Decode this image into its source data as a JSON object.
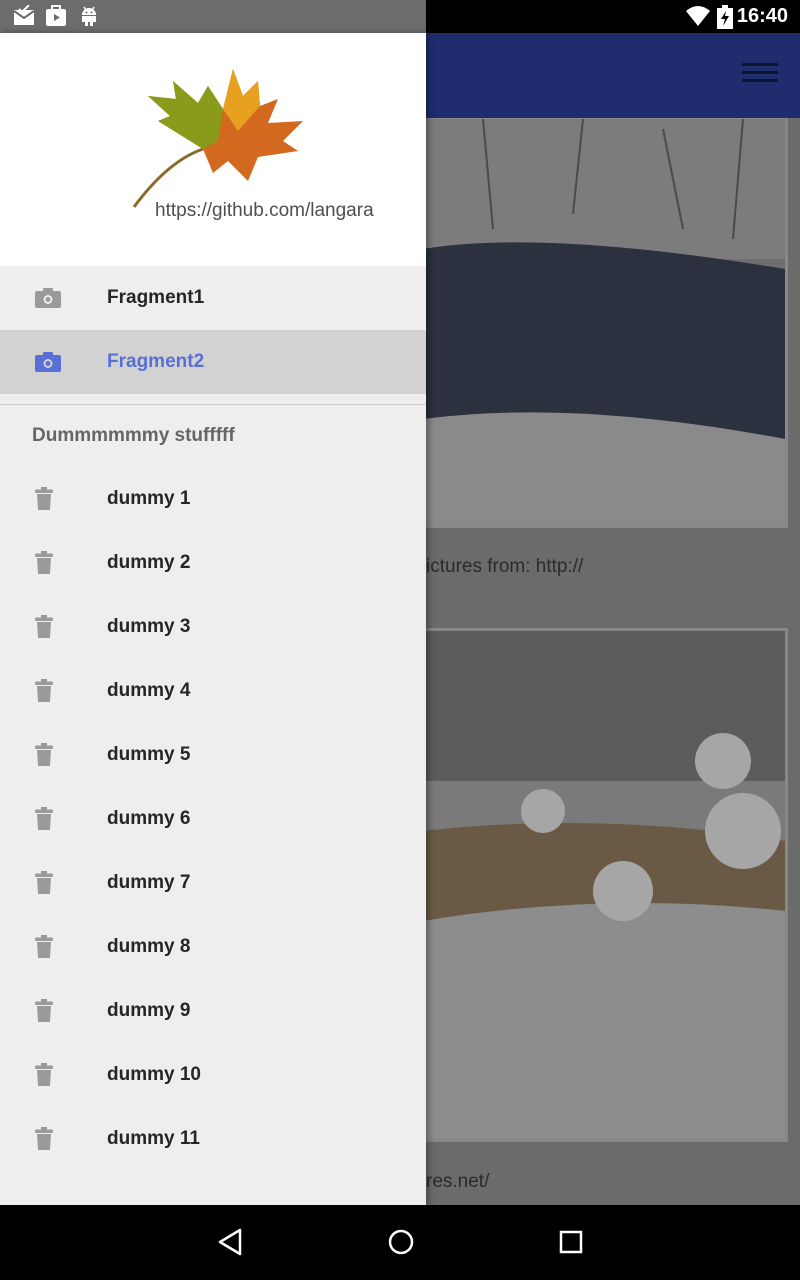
{
  "status_bar": {
    "time": "16:40",
    "left_icons": [
      "mail-icon",
      "play-store-icon",
      "android-icon"
    ],
    "right_icons": [
      "wifi-icon",
      "battery-charging-icon"
    ]
  },
  "toolbar": {
    "menu_icon": "menu-icon"
  },
  "content": {
    "credit_line_1": "ictures from: http://",
    "credit_line_2": "res.net/"
  },
  "drawer": {
    "header_link": "https://github.com/langara",
    "primary_items": [
      {
        "label": "Fragment1",
        "icon": "camera-icon",
        "active": false
      },
      {
        "label": "Fragment2",
        "icon": "camera-icon",
        "active": true
      }
    ],
    "section_title": "Dummmmmmy stufffff",
    "dummy_items": [
      {
        "label": "dummy 1",
        "icon": "trash-icon"
      },
      {
        "label": "dummy 2",
        "icon": "trash-icon"
      },
      {
        "label": "dummy 3",
        "icon": "trash-icon"
      },
      {
        "label": "dummy 4",
        "icon": "trash-icon"
      },
      {
        "label": "dummy 5",
        "icon": "trash-icon"
      },
      {
        "label": "dummy 6",
        "icon": "trash-icon"
      },
      {
        "label": "dummy 7",
        "icon": "trash-icon"
      },
      {
        "label": "dummy 8",
        "icon": "trash-icon"
      },
      {
        "label": "dummy 9",
        "icon": "trash-icon"
      },
      {
        "label": "dummy 10",
        "icon": "trash-icon"
      },
      {
        "label": "dummy 11",
        "icon": "trash-icon"
      }
    ]
  },
  "nav_bar": {
    "buttons": [
      "back-icon",
      "home-icon",
      "recents-icon"
    ]
  },
  "colors": {
    "toolbar": "#1f2d6e",
    "active_item": "#5a6fd6",
    "drawer_bg": "#eeeeee",
    "active_bg": "#d2d2d2"
  }
}
